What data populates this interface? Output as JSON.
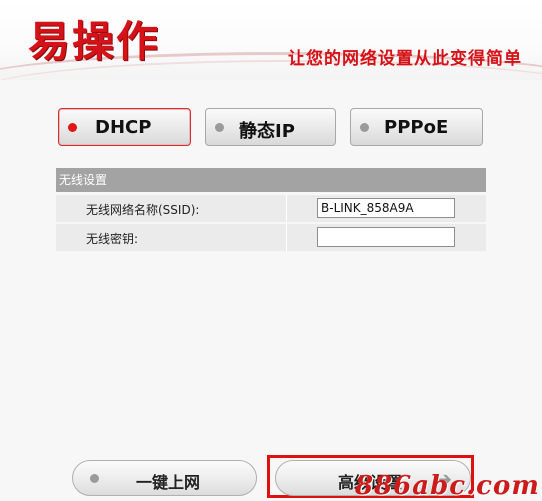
{
  "header": {
    "logo_text": "易操作",
    "slogan": "让您的网络设置从此变得简单"
  },
  "mode_tabs": [
    {
      "label": "DHCP",
      "selected": true
    },
    {
      "label": "静态IP",
      "selected": false
    },
    {
      "label": "PPPoE",
      "selected": false
    }
  ],
  "wireless": {
    "section_title": "无线设置",
    "ssid_label": "无线网络名称(SSID):",
    "ssid_value": "B-LINK_858A9A",
    "key_label": "无线密钥:",
    "key_value": ""
  },
  "buttons": {
    "quick_connect": "一键上网",
    "advanced": "高级设置"
  },
  "watermark": "886abc.com",
  "colors": {
    "brand_red": "#d51218",
    "section_header": "#a3a3a3",
    "row_bg": "#ebebeb",
    "highlight_frame": "#e01010"
  },
  "icons": {
    "advanced_arrow": "arrow-right-icon"
  }
}
